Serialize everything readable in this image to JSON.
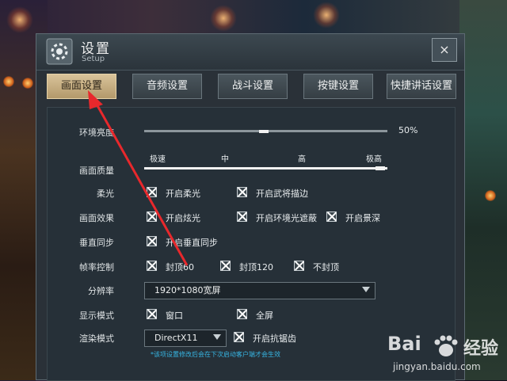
{
  "window": {
    "title": "设置",
    "subtitle": "Setup",
    "close_icon": "×"
  },
  "tabs": [
    {
      "label": "画面设置",
      "active": true
    },
    {
      "label": "音频设置",
      "active": false
    },
    {
      "label": "战斗设置",
      "active": false
    },
    {
      "label": "按键设置",
      "active": false
    },
    {
      "label": "快捷讲话设置",
      "active": false
    }
  ],
  "settings": {
    "brightness": {
      "label": "环境亮度",
      "value_text": "50%",
      "value": 0.5
    },
    "quality": {
      "label": "画面质量",
      "marks": [
        "极速",
        "中",
        "高",
        "极高"
      ],
      "level": 1.0
    },
    "soft_light": {
      "label": "柔光",
      "options": [
        "开启柔光",
        "开启武将描边"
      ]
    },
    "effects": {
      "label": "画面效果",
      "options": [
        "开启炫光",
        "开启环境光遮蔽",
        "开启景深"
      ]
    },
    "vsync": {
      "label": "垂直同步",
      "options": [
        "开启垂直同步"
      ]
    },
    "framerate": {
      "label": "帧率控制",
      "options": [
        "封顶60",
        "封顶120",
        "不封顶"
      ]
    },
    "resolution": {
      "label": "分辨率",
      "value": "1920*1080宽屏"
    },
    "display_mode": {
      "label": "显示模式",
      "options": [
        "窗口",
        "全屏"
      ]
    },
    "render_mode": {
      "label": "渲染模式",
      "value": "DirectX11",
      "antialias": "开启抗锯齿"
    },
    "note": "*该项设置修改后会在下次启动客户端才会生效"
  },
  "watermark": {
    "logo": "Bai",
    "logo_suffix": "经验",
    "url": "jingyan.baidu.com"
  },
  "colors": {
    "active_tab": "#c9b083",
    "annotation_arrow": "#e8282c",
    "note_text": "#37b6e4"
  }
}
